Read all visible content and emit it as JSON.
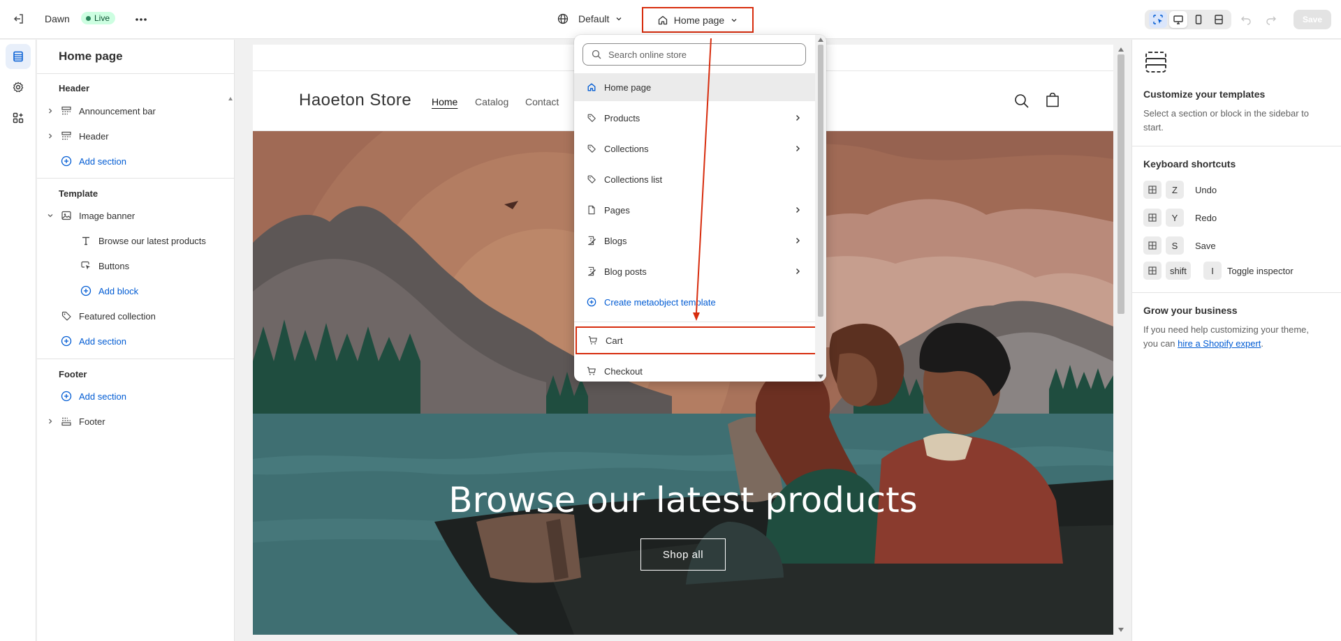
{
  "topbar": {
    "theme_name": "Dawn",
    "live_label": "Live",
    "theme_selector": "Default",
    "page_selector": "Home page",
    "save_label": "Save"
  },
  "sidebar": {
    "title": "Home page",
    "header_group": {
      "heading": "Header",
      "items": [
        "Announcement bar",
        "Header"
      ],
      "add_label": "Add section"
    },
    "template_group": {
      "heading": "Template",
      "section": "Image banner",
      "blocks": [
        "Browse our latest products",
        "Buttons"
      ],
      "add_block_label": "Add block",
      "featured": "Featured collection",
      "add_label": "Add section"
    },
    "footer_group": {
      "heading": "Footer",
      "add_label": "Add section",
      "item": "Footer"
    }
  },
  "preview": {
    "store_name": "Haoeton Store",
    "nav": [
      "Home",
      "Catalog",
      "Contact"
    ],
    "banner_title": "Browse our latest products",
    "banner_button": "Shop all"
  },
  "dropdown": {
    "search_placeholder": "Search online store",
    "items": [
      {
        "label": "Home page",
        "icon": "home-icon"
      },
      {
        "label": "Products",
        "icon": "tag-icon"
      },
      {
        "label": "Collections",
        "icon": "tag-icon"
      },
      {
        "label": "Collections list",
        "icon": "tag-icon"
      },
      {
        "label": "Pages",
        "icon": "page-icon"
      },
      {
        "label": "Blogs",
        "icon": "blog-icon"
      },
      {
        "label": "Blog posts",
        "icon": "blog-icon"
      },
      {
        "label": "Create metaobject template",
        "icon": "plus-circle-icon"
      },
      {
        "label": "Cart",
        "icon": "cart-icon"
      },
      {
        "label": "Checkout",
        "icon": "cart-icon"
      }
    ]
  },
  "rightpanel": {
    "customize_heading": "Customize your templates",
    "customize_text": "Select a section or block in the sidebar to start.",
    "shortcuts_heading": "Keyboard shortcuts",
    "shortcuts": [
      {
        "keys": [
          "Z"
        ],
        "label": "Undo"
      },
      {
        "keys": [
          "Y"
        ],
        "label": "Redo"
      },
      {
        "keys": [
          "S"
        ],
        "label": "Save"
      },
      {
        "keys": [
          "shift",
          "I"
        ],
        "label": "Toggle inspector"
      }
    ],
    "grow_heading": "Grow your business",
    "grow_text_before": "If you need help customizing your theme, you can ",
    "grow_link": "hire a Shopify expert",
    "grow_text_after": "."
  },
  "colors": {
    "accent_blue": "#005bd3",
    "highlight_red": "#d72c0d",
    "live_green": "#29845a"
  }
}
